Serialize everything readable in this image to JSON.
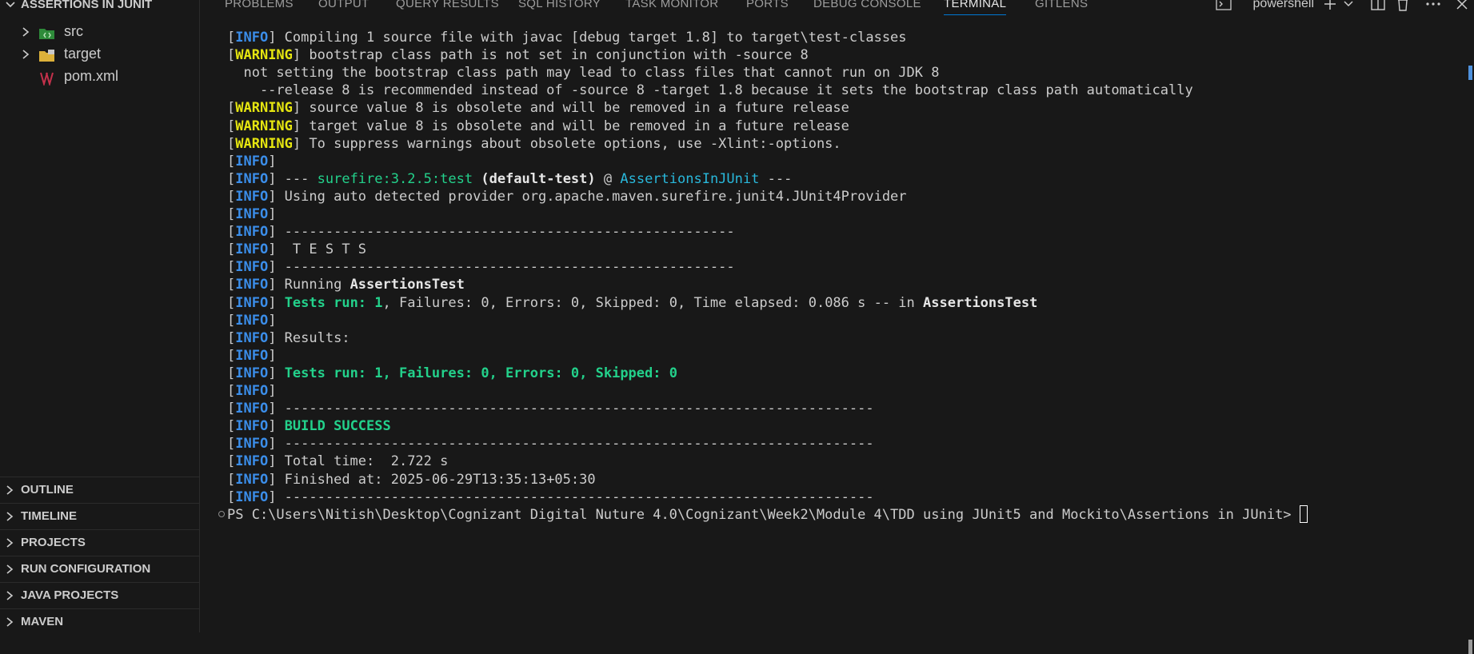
{
  "sidebar": {
    "explorer_title": "ASSERTIONS IN JUNIT",
    "tree": [
      {
        "label": "src",
        "icon": "src-folder-icon"
      },
      {
        "label": "target",
        "icon": "folder-icon"
      },
      {
        "label": "pom.xml",
        "icon": "maven-icon"
      }
    ],
    "sections": [
      "OUTLINE",
      "TIMELINE",
      "PROJECTS",
      "RUN CONFIGURATION",
      "JAVA PROJECTS",
      "MAVEN"
    ]
  },
  "panel": {
    "tabs": [
      "PROBLEMS",
      "OUTPUT",
      "QUERY RESULTS",
      "SQL HISTORY",
      "TASK MONITOR",
      "PORTS",
      "DEBUG CONSOLE",
      "TERMINAL",
      "GITLENS"
    ],
    "active_tab": "TERMINAL",
    "shell_label": "powershell"
  },
  "terminal": {
    "lines": [
      [
        [
          "b",
          "["
        ],
        [
          "info",
          "INFO"
        ],
        [
          "b",
          "] Compiling 1 source file with javac [debug target 1.8] to target\\test-classes"
        ]
      ],
      [
        [
          "b",
          "["
        ],
        [
          "warn",
          "WARNING"
        ],
        [
          "b",
          "] bootstrap class path is not set in conjunction with -source 8"
        ]
      ],
      [
        [
          "b",
          "  not setting the bootstrap class path may lead to class files that cannot run on JDK 8"
        ]
      ],
      [
        [
          "b",
          "    --release 8 is recommended instead of -source 8 -target 1.8 because it sets the bootstrap class path automatically"
        ]
      ],
      [
        [
          "b",
          "["
        ],
        [
          "warn",
          "WARNING"
        ],
        [
          "b",
          "] source value 8 is obsolete and will be removed in a future release"
        ]
      ],
      [
        [
          "b",
          "["
        ],
        [
          "warn",
          "WARNING"
        ],
        [
          "b",
          "] target value 8 is obsolete and will be removed in a future release"
        ]
      ],
      [
        [
          "b",
          "["
        ],
        [
          "warn",
          "WARNING"
        ],
        [
          "b",
          "] To suppress warnings about obsolete options, use -Xlint:-options."
        ]
      ],
      [
        [
          "b",
          "["
        ],
        [
          "info",
          "INFO"
        ],
        [
          "b",
          "]"
        ]
      ],
      [
        [
          "b",
          "["
        ],
        [
          "info",
          "INFO"
        ],
        [
          "b",
          "] --- "
        ],
        [
          "green",
          "surefire:3.2.5:test"
        ],
        [
          "b",
          " "
        ],
        [
          "bold",
          "(default-test)"
        ],
        [
          "b",
          " @ "
        ],
        [
          "cyan",
          "AssertionsInJUnit"
        ],
        [
          "b",
          " ---"
        ]
      ],
      [
        [
          "b",
          "["
        ],
        [
          "info",
          "INFO"
        ],
        [
          "b",
          "] Using auto detected provider org.apache.maven.surefire.junit4.JUnit4Provider"
        ]
      ],
      [
        [
          "b",
          "["
        ],
        [
          "info",
          "INFO"
        ],
        [
          "b",
          "]"
        ]
      ],
      [
        [
          "b",
          "["
        ],
        [
          "info",
          "INFO"
        ],
        [
          "b",
          "] -------------------------------------------------------"
        ]
      ],
      [
        [
          "b",
          "["
        ],
        [
          "info",
          "INFO"
        ],
        [
          "b",
          "]  T E S T S"
        ]
      ],
      [
        [
          "b",
          "["
        ],
        [
          "info",
          "INFO"
        ],
        [
          "b",
          "] -------------------------------------------------------"
        ]
      ],
      [
        [
          "b",
          "["
        ],
        [
          "info",
          "INFO"
        ],
        [
          "b",
          "] Running "
        ],
        [
          "bold",
          "AssertionsTest"
        ]
      ],
      [
        [
          "b",
          "["
        ],
        [
          "info",
          "INFO"
        ],
        [
          "b",
          "] "
        ],
        [
          "greenb",
          "Tests run: 1"
        ],
        [
          "b",
          ", Failures: 0, Errors: 0, Skipped: 0, Time elapsed: 0.086 s -- in "
        ],
        [
          "bold",
          "AssertionsTest"
        ]
      ],
      [
        [
          "b",
          "["
        ],
        [
          "info",
          "INFO"
        ],
        [
          "b",
          "]"
        ]
      ],
      [
        [
          "b",
          "["
        ],
        [
          "info",
          "INFO"
        ],
        [
          "b",
          "] Results:"
        ]
      ],
      [
        [
          "b",
          "["
        ],
        [
          "info",
          "INFO"
        ],
        [
          "b",
          "]"
        ]
      ],
      [
        [
          "b",
          "["
        ],
        [
          "info",
          "INFO"
        ],
        [
          "b",
          "] "
        ],
        [
          "greenb",
          "Tests run: 1, Failures: 0, Errors: 0, Skipped: 0"
        ]
      ],
      [
        [
          "b",
          "["
        ],
        [
          "info",
          "INFO"
        ],
        [
          "b",
          "]"
        ]
      ],
      [
        [
          "b",
          "["
        ],
        [
          "info",
          "INFO"
        ],
        [
          "b",
          "] ------------------------------------------------------------------------"
        ]
      ],
      [
        [
          "b",
          "["
        ],
        [
          "info",
          "INFO"
        ],
        [
          "b",
          "] "
        ],
        [
          "greenb",
          "BUILD SUCCESS"
        ]
      ],
      [
        [
          "b",
          "["
        ],
        [
          "info",
          "INFO"
        ],
        [
          "b",
          "] ------------------------------------------------------------------------"
        ]
      ],
      [
        [
          "b",
          "["
        ],
        [
          "info",
          "INFO"
        ],
        [
          "b",
          "] Total time:  2.722 s"
        ]
      ],
      [
        [
          "b",
          "["
        ],
        [
          "info",
          "INFO"
        ],
        [
          "b",
          "] Finished at: 2025-06-29T13:35:13+05:30"
        ]
      ],
      [
        [
          "b",
          "["
        ],
        [
          "info",
          "INFO"
        ],
        [
          "b",
          "] ------------------------------------------------------------------------"
        ]
      ]
    ],
    "prompt": "PS C:\\Users\\Nitish\\Desktop\\Cognizant Digital Nuture 4.0\\Cognizant\\Week2\\Module 4\\TDD using JUnit5 and Mockito\\Assertions in JUnit> "
  },
  "colors": {
    "background": "#181818",
    "info": "#3b8eea",
    "warning": "#e5e510",
    "success": "#23d18b",
    "project": "#29b8db",
    "accent": "#0078d4"
  }
}
